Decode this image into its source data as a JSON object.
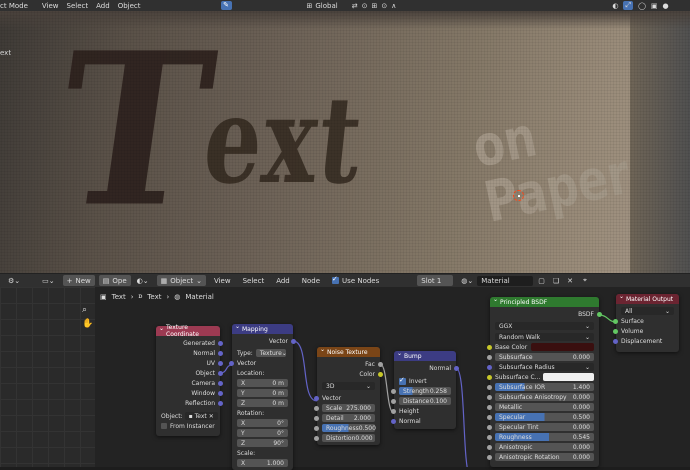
{
  "topbar": {
    "mode_label": "ct Mode",
    "menus": [
      "View",
      "Select",
      "Add",
      "Object"
    ],
    "transform_orientation": "Global"
  },
  "viewport": {
    "text_label": "ext",
    "scene_text_main": "Text",
    "scene_text_sub": "on Paper"
  },
  "node_header": {
    "object_label": "Object",
    "menus": [
      "View",
      "Select",
      "Add",
      "Node"
    ],
    "new_label": "New",
    "open_label": "Ope",
    "use_nodes_label": "Use Nodes",
    "slot_label": "Slot 1",
    "material_name": "Material"
  },
  "breadcrumb": [
    "Text",
    "Text",
    "Material"
  ],
  "nodes": {
    "texcoord": {
      "title": "Texture Coordinate",
      "outputs": [
        "Generated",
        "Normal",
        "UV",
        "Object",
        "Camera",
        "Window",
        "Reflection"
      ],
      "object_label": "Object:",
      "object_value": "Text",
      "from_instancer": "From Instancer"
    },
    "mapping": {
      "title": "Mapping",
      "output": "Vector",
      "type_label": "Type:",
      "type_value": "Texture",
      "vector_in": "Vector",
      "location_label": "Location:",
      "location": [
        [
          "X",
          "0 m"
        ],
        [
          "Y",
          "0 m"
        ],
        [
          "Z",
          "0 m"
        ]
      ],
      "rotation_label": "Rotation:",
      "rotation": [
        [
          "X",
          "0°"
        ],
        [
          "Y",
          "0°"
        ],
        [
          "Z",
          "90°"
        ]
      ],
      "scale_label": "Scale:",
      "scale": [
        [
          "X",
          "1.000"
        ]
      ]
    },
    "noise": {
      "title": "Noise Texture",
      "outputs": [
        "Fac",
        "Color"
      ],
      "dimensions": "3D",
      "vector_in": "Vector",
      "params": [
        [
          "Scale",
          "275.000"
        ],
        [
          "Detail",
          "2.000"
        ],
        [
          "Roughness",
          "0.500"
        ],
        [
          "Distortion",
          "0.000"
        ]
      ]
    },
    "bump": {
      "title": "Bump",
      "output": "Normal",
      "invert_label": "Invert",
      "params": [
        [
          "Strength",
          "0.258"
        ],
        [
          "Distance",
          "0.100"
        ]
      ],
      "inputs": [
        "Height",
        "Normal"
      ]
    },
    "bsdf": {
      "title": "Principled BSDF",
      "output": "BSDF",
      "distribution": "GGX",
      "subsurface_method": "Random Walk",
      "base_color_label": "Base Color",
      "base_color": "#3a0f0f",
      "params": [
        [
          "Subsurface",
          "0.000"
        ],
        [
          "Subsurface Radius",
          ""
        ],
        [
          "Subsurface C...",
          ""
        ],
        [
          "Subsurface IOR",
          "1.400"
        ],
        [
          "Subsurface Anisotropy",
          "0.000"
        ],
        [
          "Metallic",
          "0.000"
        ],
        [
          "Specular",
          "0.500"
        ],
        [
          "Specular Tint",
          "0.000"
        ],
        [
          "Roughness",
          "0.545"
        ],
        [
          "Anisotropic",
          "0.000"
        ],
        [
          "Anisotropic Rotation",
          "0.000"
        ]
      ],
      "specular_fill": 0.5,
      "roughness_fill": 0.545
    },
    "output": {
      "title": "Material Output",
      "target": "All",
      "inputs": [
        "Surface",
        "Volume",
        "Displacement"
      ]
    }
  },
  "colors": {
    "accent_blue": "#4772b3",
    "texcoord_header": "#9c3a52",
    "mapping_header": "#3c3c83",
    "noise_header": "#7a4517",
    "bump_header": "#3c3c83",
    "bsdf_header": "#2f7a2f",
    "output_header": "#6b2431"
  }
}
